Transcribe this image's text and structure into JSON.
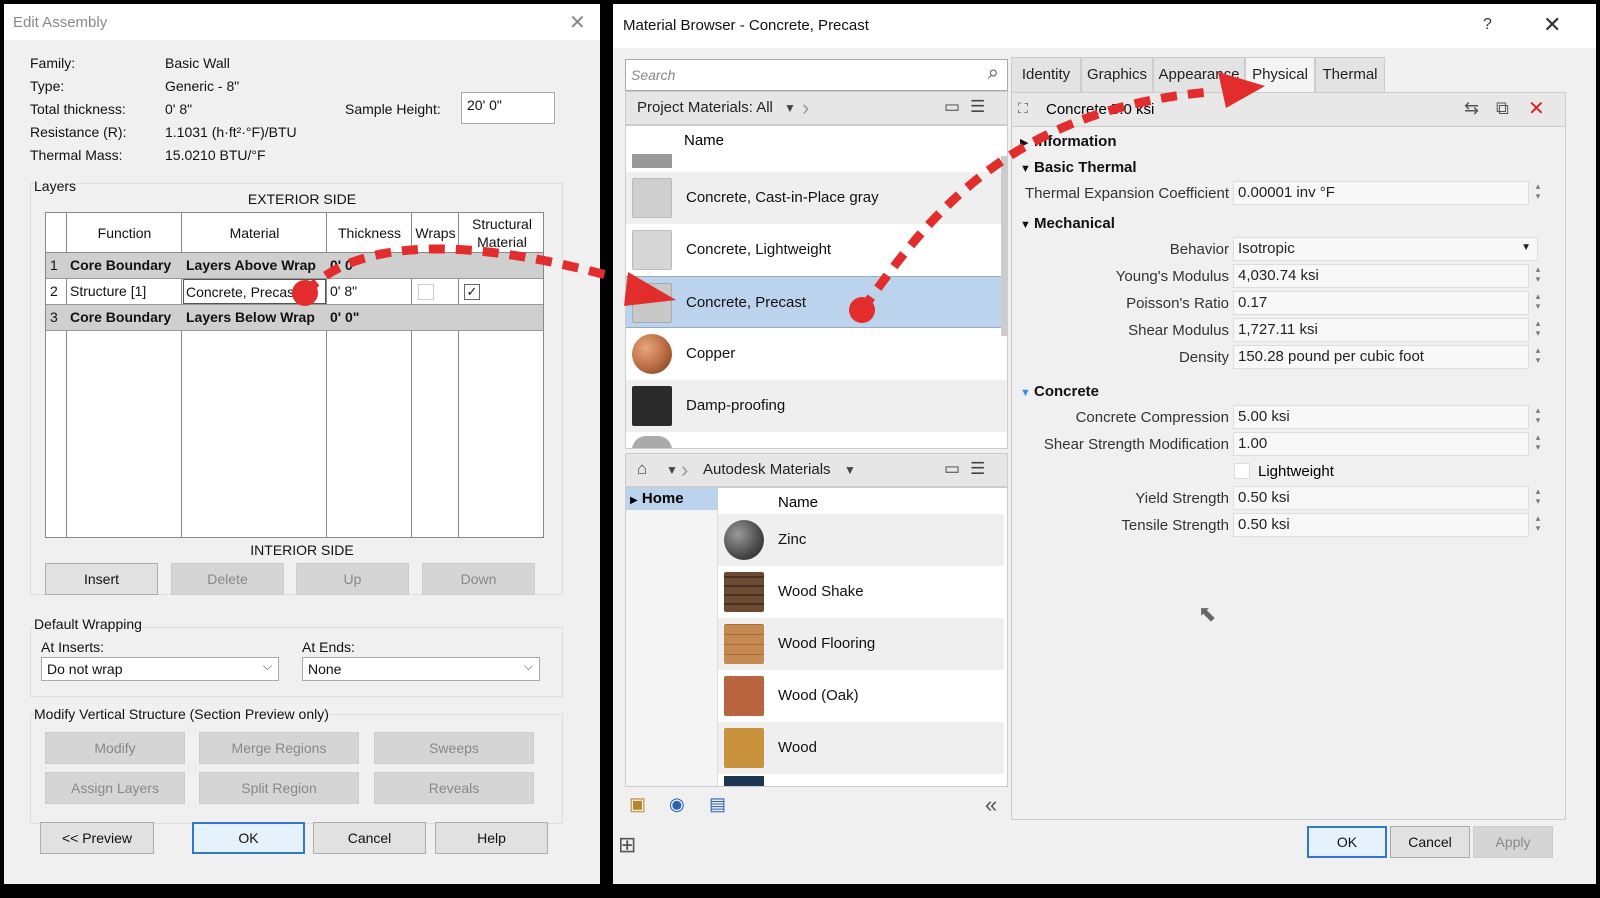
{
  "edit_assembly": {
    "title": "Edit Assembly",
    "properties": [
      {
        "label": "Family:",
        "value": "Basic Wall"
      },
      {
        "label": "Type:",
        "value": "Generic - 8\""
      },
      {
        "label": "Total thickness:",
        "value": "0'  8\""
      },
      {
        "label": "Resistance (R):",
        "value": "1.1031 (h·ft²·°F)/BTU"
      },
      {
        "label": "Thermal Mass:",
        "value": "15.0210 BTU/°F"
      }
    ],
    "sample_height_label": "Sample Height:",
    "sample_height_value": "20'  0\"",
    "layers_label": "Layers",
    "exterior_side": "EXTERIOR SIDE",
    "interior_side": "INTERIOR SIDE",
    "columns": [
      "Function",
      "Material",
      "Thickness",
      "Wraps",
      "Structural Material"
    ],
    "rows": [
      {
        "num": "1",
        "function": "Core Boundary",
        "material": "Layers Above Wrap",
        "thickness": "0'  0\"",
        "wraps": null,
        "structural": null
      },
      {
        "num": "2",
        "function": "Structure [1]",
        "material": "Concrete, Precast",
        "thickness": "0'  8\"",
        "wraps": false,
        "structural": true
      },
      {
        "num": "3",
        "function": "Core Boundary",
        "material": "Layers Below Wrap",
        "thickness": "0'  0\"",
        "wraps": null,
        "structural": null
      }
    ],
    "layer_buttons": [
      "Insert",
      "Delete",
      "Up",
      "Down"
    ],
    "default_wrapping_label": "Default Wrapping",
    "at_inserts_label": "At Inserts:",
    "at_inserts_value": "Do not wrap",
    "at_ends_label": "At  Ends:",
    "at_ends_value": "None",
    "modify_label": "Modify Vertical Structure (Section Preview only)",
    "modify_buttons": [
      "Modify",
      "Merge Regions",
      "Sweeps",
      "Assign Layers",
      "Split Region",
      "Reveals"
    ],
    "footer_buttons": [
      "<< Preview",
      "OK",
      "Cancel",
      "Help"
    ]
  },
  "material_browser": {
    "title": "Material Browser - Concrete, Precast",
    "help": "?",
    "search_placeholder": "Search",
    "project_materials_label": "Project Materials: All",
    "name_header": "Name",
    "project_materials": [
      {
        "name": "Concrete, Cast-in-Place gray",
        "color": "#cfcfcf"
      },
      {
        "name": "Concrete, Lightweight",
        "color": "#d6d6d6"
      },
      {
        "name": "Concrete, Precast",
        "color": "#c8c8c8",
        "selected": true
      },
      {
        "name": "Copper",
        "color": "#b86a40"
      },
      {
        "name": "Damp-proofing",
        "color": "#2a2a2a"
      }
    ],
    "library_label": "Autodesk Materials",
    "home_label": "Home",
    "library_materials": [
      {
        "name": "Zinc",
        "color": "#5a5a5a"
      },
      {
        "name": "Wood Shake",
        "color": "#6d4a32"
      },
      {
        "name": "Wood Flooring",
        "color": "#c58a52"
      },
      {
        "name": "Wood (Oak)",
        "color": "#b8643e"
      },
      {
        "name": "Wood",
        "color": "#c9923c"
      }
    ],
    "tabs": [
      "Identity",
      "Graphics",
      "Appearance",
      "Physical",
      "Thermal"
    ],
    "active_tab": "Physical",
    "asset_name": "Concrete 5.0 ksi",
    "sections": {
      "information": "Information",
      "basic_thermal": "Basic Thermal",
      "mechanical": "Mechanical",
      "concrete": "Concrete"
    },
    "thermal_expansion_label": "Thermal Expansion Coefficient",
    "thermal_expansion_value": "0.00001 inv °F",
    "behavior_label": "Behavior",
    "behavior_value": "Isotropic",
    "youngs_label": "Young's Modulus",
    "youngs_value": "4,030.74 ksi",
    "poisson_label": "Poisson's Ratio",
    "poisson_value": "0.17",
    "shear_label": "Shear Modulus",
    "shear_value": "1,727.11 ksi",
    "density_label": "Density",
    "density_value": "150.28 pound per cubic foot",
    "compression_label": "Concrete Compression",
    "compression_value": "5.00 ksi",
    "shear_mod_label": "Shear Strength Modification",
    "shear_mod_value": "1.00",
    "lightweight_label": "Lightweight",
    "yield_label": "Yield Strength",
    "yield_value": "0.50 ksi",
    "tensile_label": "Tensile Strength",
    "tensile_value": "0.50 ksi",
    "footer_buttons": [
      "OK",
      "Cancel",
      "Apply"
    ]
  },
  "annotation_color": "#e32d2d"
}
